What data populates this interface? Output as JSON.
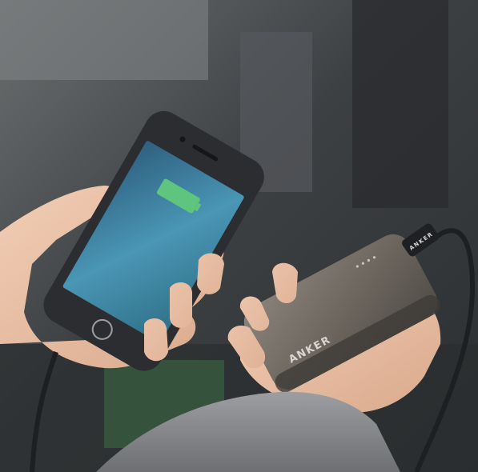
{
  "photo": {
    "powerbank_brand": "ANKER",
    "plug_brand": "ANKER"
  },
  "colors": {
    "battery_indicator": "#5ec47e",
    "powerbank_body": "#6f6a63",
    "phone_body": "#2b2d31",
    "screen_blue": "#3f86a8",
    "skin": "#e9c2a9",
    "sleeve": "#8a8c8f",
    "cable": "#1d1f22"
  }
}
